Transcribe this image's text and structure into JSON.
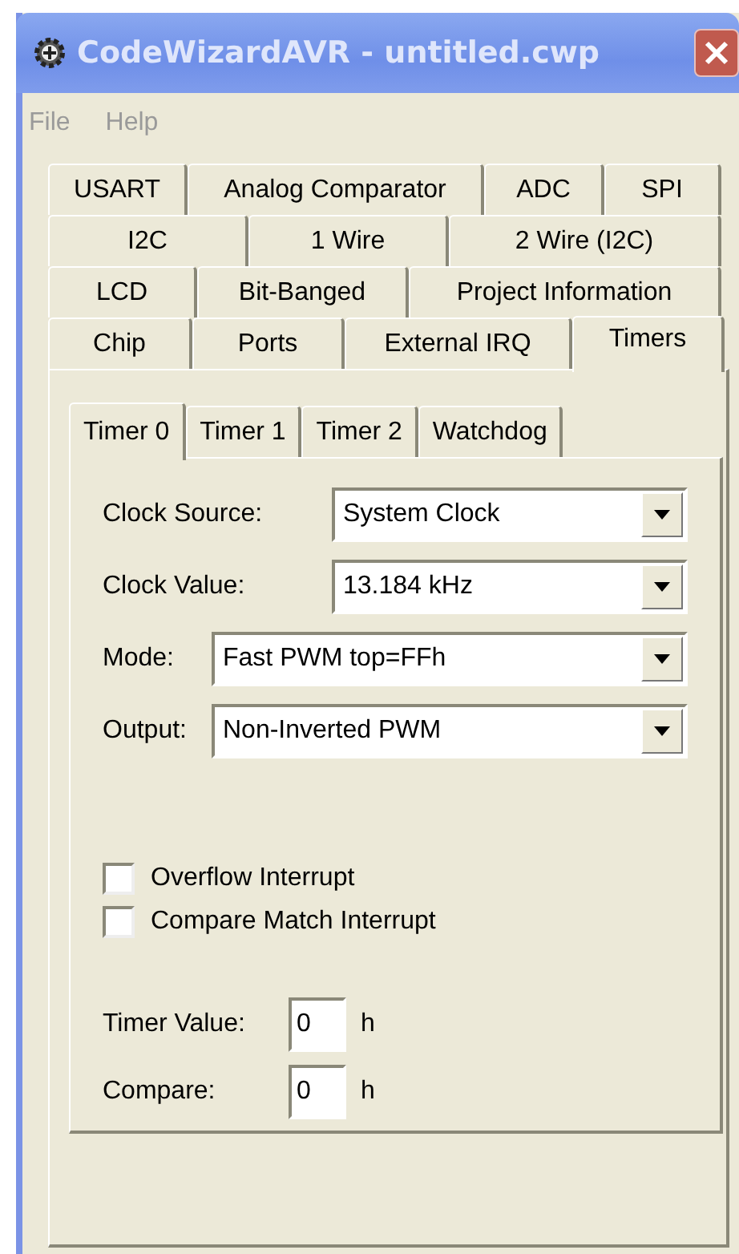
{
  "window": {
    "title": "CodeWizardAVR - untitled.cwp"
  },
  "menu": [
    "File",
    "Help"
  ],
  "tab_rows": [
    [
      {
        "label": "USART",
        "selected": false
      },
      {
        "label": "Analog Comparator",
        "selected": false
      },
      {
        "label": "ADC",
        "selected": false
      },
      {
        "label": "SPI",
        "selected": false
      }
    ],
    [
      {
        "label": "I2C",
        "selected": false
      },
      {
        "label": "1 Wire",
        "selected": false
      },
      {
        "label": "2 Wire (I2C)",
        "selected": false
      }
    ],
    [
      {
        "label": "LCD",
        "selected": false
      },
      {
        "label": "Bit-Banged",
        "selected": false
      },
      {
        "label": "Project Information",
        "selected": false
      }
    ],
    [
      {
        "label": "Chip",
        "selected": false
      },
      {
        "label": "Ports",
        "selected": false
      },
      {
        "label": "External IRQ",
        "selected": false
      },
      {
        "label": "Timers",
        "selected": true
      }
    ]
  ],
  "subtabs": [
    {
      "label": "Timer 0",
      "selected": true
    },
    {
      "label": "Timer 1",
      "selected": false
    },
    {
      "label": "Timer 2",
      "selected": false
    },
    {
      "label": "Watchdog",
      "selected": false
    }
  ],
  "dropdowns": [
    {
      "label": "Clock Source:",
      "value": "System Clock"
    },
    {
      "label": "Clock Value:",
      "value": "13.184 kHz"
    },
    {
      "label": "Mode:",
      "value": "Fast PWM top=FFh"
    },
    {
      "label": "Output:",
      "value": "Non-Inverted PWM"
    }
  ],
  "checkboxes": [
    {
      "label": "Overflow Interrupt",
      "checked": false
    },
    {
      "label": "Compare Match Interrupt",
      "checked": false
    }
  ],
  "hex_fields": [
    {
      "label": "Timer Value:",
      "value": "0",
      "suffix": "h"
    },
    {
      "label": "Compare:",
      "value": "0",
      "suffix": "h"
    }
  ]
}
